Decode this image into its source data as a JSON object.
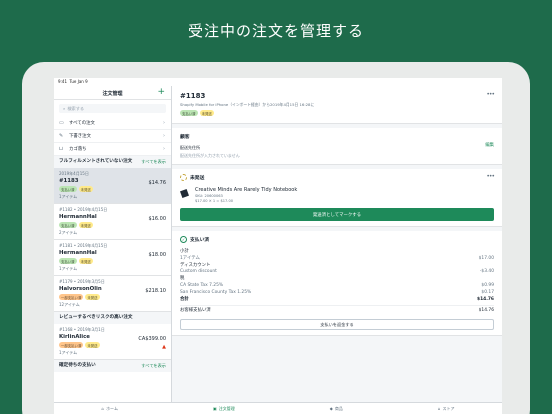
{
  "headline": "受注中の注文を管理する",
  "status_bar": {
    "time": "9:41",
    "date": "Tue Jan 9"
  },
  "sidebar": {
    "title": "注文管理",
    "search_placeholder": "検索する",
    "nav": [
      {
        "label": "すべての注文",
        "icon": "inbox-icon"
      },
      {
        "label": "下書き注文",
        "icon": "draft-icon"
      },
      {
        "label": "カゴ落ち",
        "icon": "cart-icon"
      }
    ],
    "unfulfilled": {
      "title": "フルフィルメントされていない注文",
      "link": "すべてを表示",
      "orders": [
        {
          "date": "2019年4月15日",
          "name": "#1183",
          "price": "$14.76",
          "badges": [
            {
              "text": "支払い済",
              "kind": "green"
            },
            {
              "text": "未発送",
              "kind": "yellow"
            }
          ],
          "items": "1アイテム"
        },
        {
          "date": "#1182 • 2019年4月15日",
          "name": "HermannHal",
          "price": "$16.00",
          "badges": [
            {
              "text": "支払い済",
              "kind": "green"
            },
            {
              "text": "未発送",
              "kind": "yellow"
            }
          ],
          "items": "2アイテム"
        },
        {
          "date": "#1181 • 2019年4月15日",
          "name": "HermannHal",
          "price": "$18.00",
          "badges": [
            {
              "text": "支払い済",
              "kind": "green"
            },
            {
              "text": "未発送",
              "kind": "yellow"
            }
          ],
          "items": "1アイテム"
        },
        {
          "date": "#1179 • 2019年3月5日",
          "name": "HalvorsonOlin",
          "price": "$218.10",
          "badges": [
            {
              "text": "一部支払い済",
              "kind": "orange"
            },
            {
              "text": "未発送",
              "kind": "yellow"
            }
          ],
          "items": "12アイテム"
        }
      ]
    },
    "risk": {
      "title": "レビューするべきリスクの高い注文",
      "orders": [
        {
          "date": "#1168 • 2019年3月1日",
          "name": "KirlinAlice",
          "price": "CA$399.00",
          "badges": [
            {
              "text": "一部支払い済",
              "kind": "orange"
            },
            {
              "text": "未発送",
              "kind": "yellow"
            }
          ],
          "items": "1アイテム"
        }
      ]
    },
    "pending": {
      "title": "確定待ちの支払い",
      "link": "すべてを表示"
    }
  },
  "tabbar": [
    {
      "label": "ホーム",
      "icon": "home-icon",
      "active": false
    },
    {
      "label": "注文管理",
      "icon": "orders-icon",
      "active": true
    },
    {
      "label": "商品",
      "icon": "tag-icon",
      "active": false
    },
    {
      "label": "ストア",
      "icon": "store-icon",
      "active": false
    }
  ],
  "detail": {
    "title": "#1183",
    "subtitle": "Shopify Mobile for iPhone（インポート経由）から2019年4月15日 16:28に",
    "badges": [
      {
        "text": "支払い済",
        "kind": "green"
      },
      {
        "text": "未発送",
        "kind": "yellow"
      }
    ],
    "customer": {
      "title": "顧客",
      "address_label": "配送先住所",
      "address_value": "配送先住所が入力されていません",
      "edit": "編集"
    },
    "unfulfilled": {
      "title": "未発送",
      "product_name": "Creative Minds Are Rarely Tidy Notebook",
      "sku": "SKU: 20600063",
      "price_line": "$17.00 ✕ 1 = $17.00",
      "button": "発送済としてマークする"
    },
    "payment": {
      "title": "支払い済",
      "lines": [
        {
          "label": "小計",
          "value": "",
          "style": "normal"
        },
        {
          "label": "1アイテム",
          "value": "$17.00",
          "style": "sub"
        },
        {
          "label": "ディスカウント",
          "value": "",
          "style": "normal"
        },
        {
          "label": "Custom discount",
          "value": "-$3.40",
          "style": "sub"
        },
        {
          "label": "税",
          "value": "",
          "style": "normal"
        },
        {
          "label": "CA State Tax 7.25%",
          "value": "$0.99",
          "style": "sub"
        },
        {
          "label": "San Francisco County Tax 1.25%",
          "value": "$0.17",
          "style": "sub"
        },
        {
          "label": "合計",
          "value": "$14.76",
          "style": "bold"
        }
      ],
      "paid_label": "お客様支払い済",
      "paid_value": "$14.76",
      "refund_button": "支払いを返金する"
    }
  },
  "colors": {
    "brand": "#1e6b4b",
    "accent": "#1e8a5a",
    "paid_badge": "#bbe5b3",
    "unfulfilled_badge": "#ffea8a",
    "partial_badge": "#ffc58b",
    "risk": "#de3618"
  }
}
